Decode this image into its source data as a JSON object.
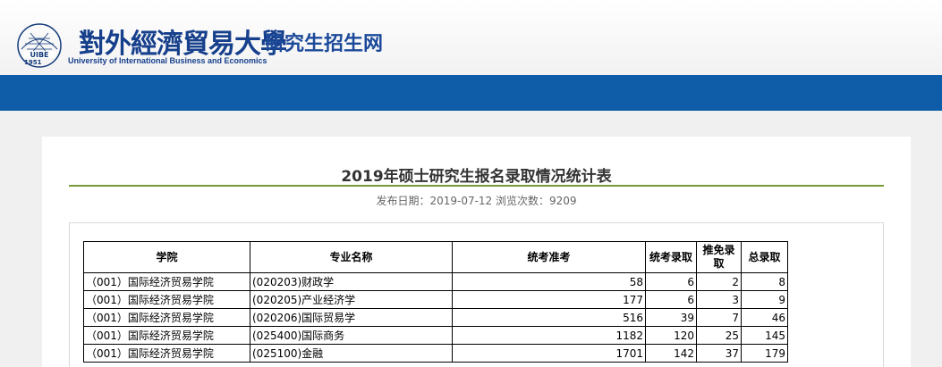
{
  "header": {
    "logo_year": "1951",
    "university_cn": "對外經濟貿易大學",
    "university_en": "University of International Business and Economics",
    "site_name": "研究生招生网"
  },
  "article": {
    "title": "2019年硕士研究生报名录取情况统计表",
    "meta": "发布日期：2019-07-12 浏览次数：9209"
  },
  "table": {
    "headers": [
      "学院",
      "专业名称",
      "统考准考",
      "统考录取",
      "推免录取",
      "总录取"
    ],
    "rows": [
      [
        "（001）国际经济贸易学院",
        "(020203)财政学",
        "58",
        "6",
        "2",
        "8"
      ],
      [
        "（001）国际经济贸易学院",
        "(020205)产业经济学",
        "177",
        "6",
        "3",
        "9"
      ],
      [
        "（001）国际经济贸易学院",
        "(020206)国际贸易学",
        "516",
        "39",
        "7",
        "46"
      ],
      [
        "（001）国际经济贸易学院",
        "(025400)国际商务",
        "1182",
        "120",
        "25",
        "145"
      ],
      [
        "（001）国际经济贸易学院",
        "(025100)金融",
        "1701",
        "142",
        "37",
        "179"
      ]
    ]
  },
  "colors": {
    "nav_bar": "#0f5ca8",
    "brand_blue": "#163f8c",
    "title_rule": "#7a9a3a"
  }
}
